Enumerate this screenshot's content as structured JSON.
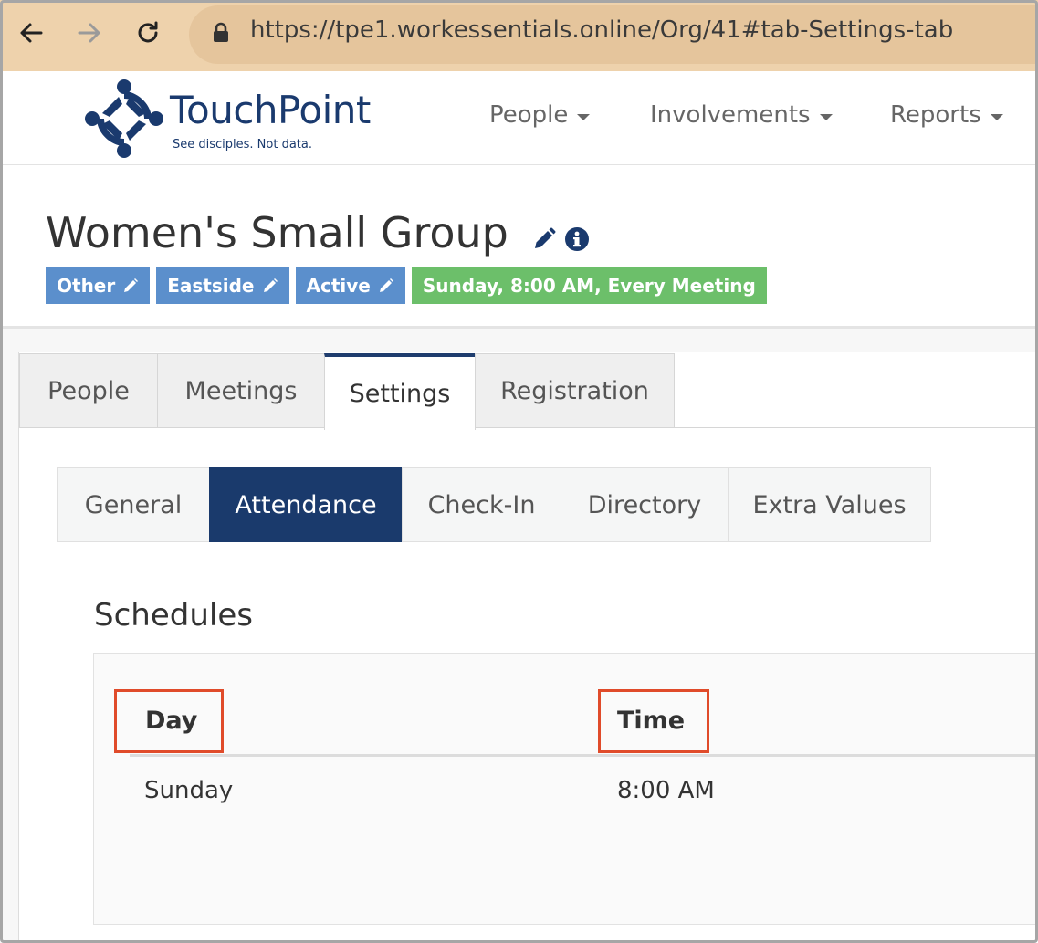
{
  "browser": {
    "url": "https://tpe1.workessentials.online/Org/41#tab-Settings-tab",
    "back_icon": "arrow-left-icon",
    "forward_icon": "arrow-right-icon",
    "reload_icon": "reload-icon",
    "lock_icon": "lock-icon"
  },
  "brand": {
    "name": "TouchPoint",
    "tagline": "See disciples. Not data.",
    "color": "#1a3a6e"
  },
  "topnav": {
    "items": [
      {
        "label": "People"
      },
      {
        "label": "Involvements"
      },
      {
        "label": "Reports"
      }
    ]
  },
  "org": {
    "title": "Women's Small Group",
    "badges": [
      {
        "label": "Other",
        "color": "#5b8fcc"
      },
      {
        "label": "Eastside",
        "color": "#5b8fcc"
      },
      {
        "label": "Active",
        "color": "#5b8fcc"
      },
      {
        "label": "Sunday, 8:00 AM, Every Meeting",
        "color": "#6cbf6a"
      }
    ]
  },
  "tabs": {
    "items": [
      {
        "label": "People"
      },
      {
        "label": "Meetings"
      },
      {
        "label": "Settings"
      },
      {
        "label": "Registration"
      }
    ],
    "active": "Settings",
    "active_color": "#1f3d6e"
  },
  "subtabs": {
    "items": [
      {
        "label": "General"
      },
      {
        "label": "Attendance"
      },
      {
        "label": "Check-In"
      },
      {
        "label": "Directory"
      },
      {
        "label": "Extra Values"
      }
    ],
    "active": "Attendance",
    "active_color": "#1a3a6c"
  },
  "schedules": {
    "title": "Schedules",
    "columns": [
      "Day",
      "Time"
    ],
    "rows": [
      [
        "Sunday",
        "8:00 AM"
      ]
    ],
    "highlight_color": "#e04b2a"
  }
}
